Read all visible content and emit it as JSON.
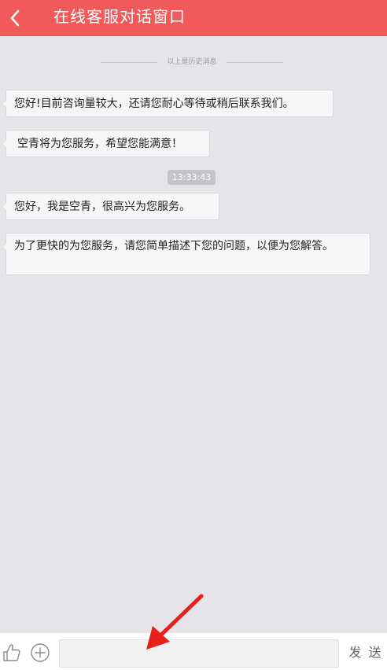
{
  "header": {
    "title": "在线客服对话窗口",
    "back_icon": "chevron-left-icon"
  },
  "chat": {
    "history_divider": "以上是历史消息",
    "timestamp": "13:33:43",
    "messages": [
      {
        "text": "您好!目前咨询量较大，还请您耐心等待或稍后联系我们。"
      },
      {
        "text": "空青将为您服务，希望您能满意！"
      },
      {
        "text": "您好，我是空青，很高兴为您服务。"
      },
      {
        "text": "为了更快的为您服务，请您简单描述下您的问题，以便为您解答。"
      }
    ]
  },
  "footer": {
    "input_value": "",
    "send_label": "发 送",
    "like_icon": "thumbs-up-icon",
    "add_icon": "plus-circle-icon"
  },
  "colors": {
    "header_bg": "#f05a5b",
    "chat_bg": "#e5e4e9",
    "arrow": "#e8201a"
  }
}
